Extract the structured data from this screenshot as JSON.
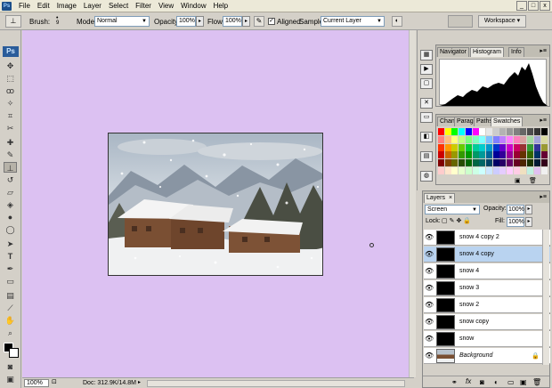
{
  "menubar": {
    "items": [
      "File",
      "Edit",
      "Image",
      "Layer",
      "Select",
      "Filter",
      "View",
      "Window",
      "Help"
    ],
    "window_buttons": [
      "_",
      "□",
      "x"
    ]
  },
  "options": {
    "brush_label": "Brush:",
    "brush_size": "9",
    "mode_label": "Mode:",
    "mode_value": "Normal",
    "opacity_label": "Opacity:",
    "opacity_value": "100%",
    "flow_label": "Flow:",
    "flow_value": "100%",
    "aligned_label": "Aligned",
    "sample_label": "Sample:",
    "sample_value": "Current Layer",
    "workspace_label": "Workspace ▾"
  },
  "toolbox": {
    "logo": "Ps"
  },
  "status": {
    "zoom": "100%",
    "doc": "Doc: 312.9K/14.8M"
  },
  "navigator_panel": {
    "tabs": [
      "Navigator",
      "Histogram",
      "Info"
    ],
    "active_tab": 1
  },
  "swatches_panel": {
    "tabs": [
      "Chan",
      "Parag",
      "Paths",
      "Swatches"
    ],
    "active_tab": 3
  },
  "layers_panel": {
    "tab": "Layers",
    "blend_mode": "Screen",
    "opacity_label": "Opacity:",
    "opacity_value": "100%",
    "lock_label": "Lock:",
    "fill_label": "Fill:",
    "fill_value": "100%",
    "layers": [
      {
        "name": "snow 4 copy 2",
        "selected": false
      },
      {
        "name": "snow 4 copy",
        "selected": true
      },
      {
        "name": "snow 4",
        "selected": false
      },
      {
        "name": "snow 3",
        "selected": false
      },
      {
        "name": "snow 2",
        "selected": false
      },
      {
        "name": "snow copy",
        "selected": false
      },
      {
        "name": "snow",
        "selected": false
      },
      {
        "name": "Background",
        "selected": false
      }
    ],
    "footer_icons": [
      "link-icon",
      "fx-icon",
      "mask-icon",
      "adjustment-icon",
      "folder-icon",
      "new-layer-icon",
      "trash-icon"
    ]
  },
  "colors": {
    "canvas_bg": "#dcc1f2",
    "selected_layer": "#b9d3f0"
  }
}
